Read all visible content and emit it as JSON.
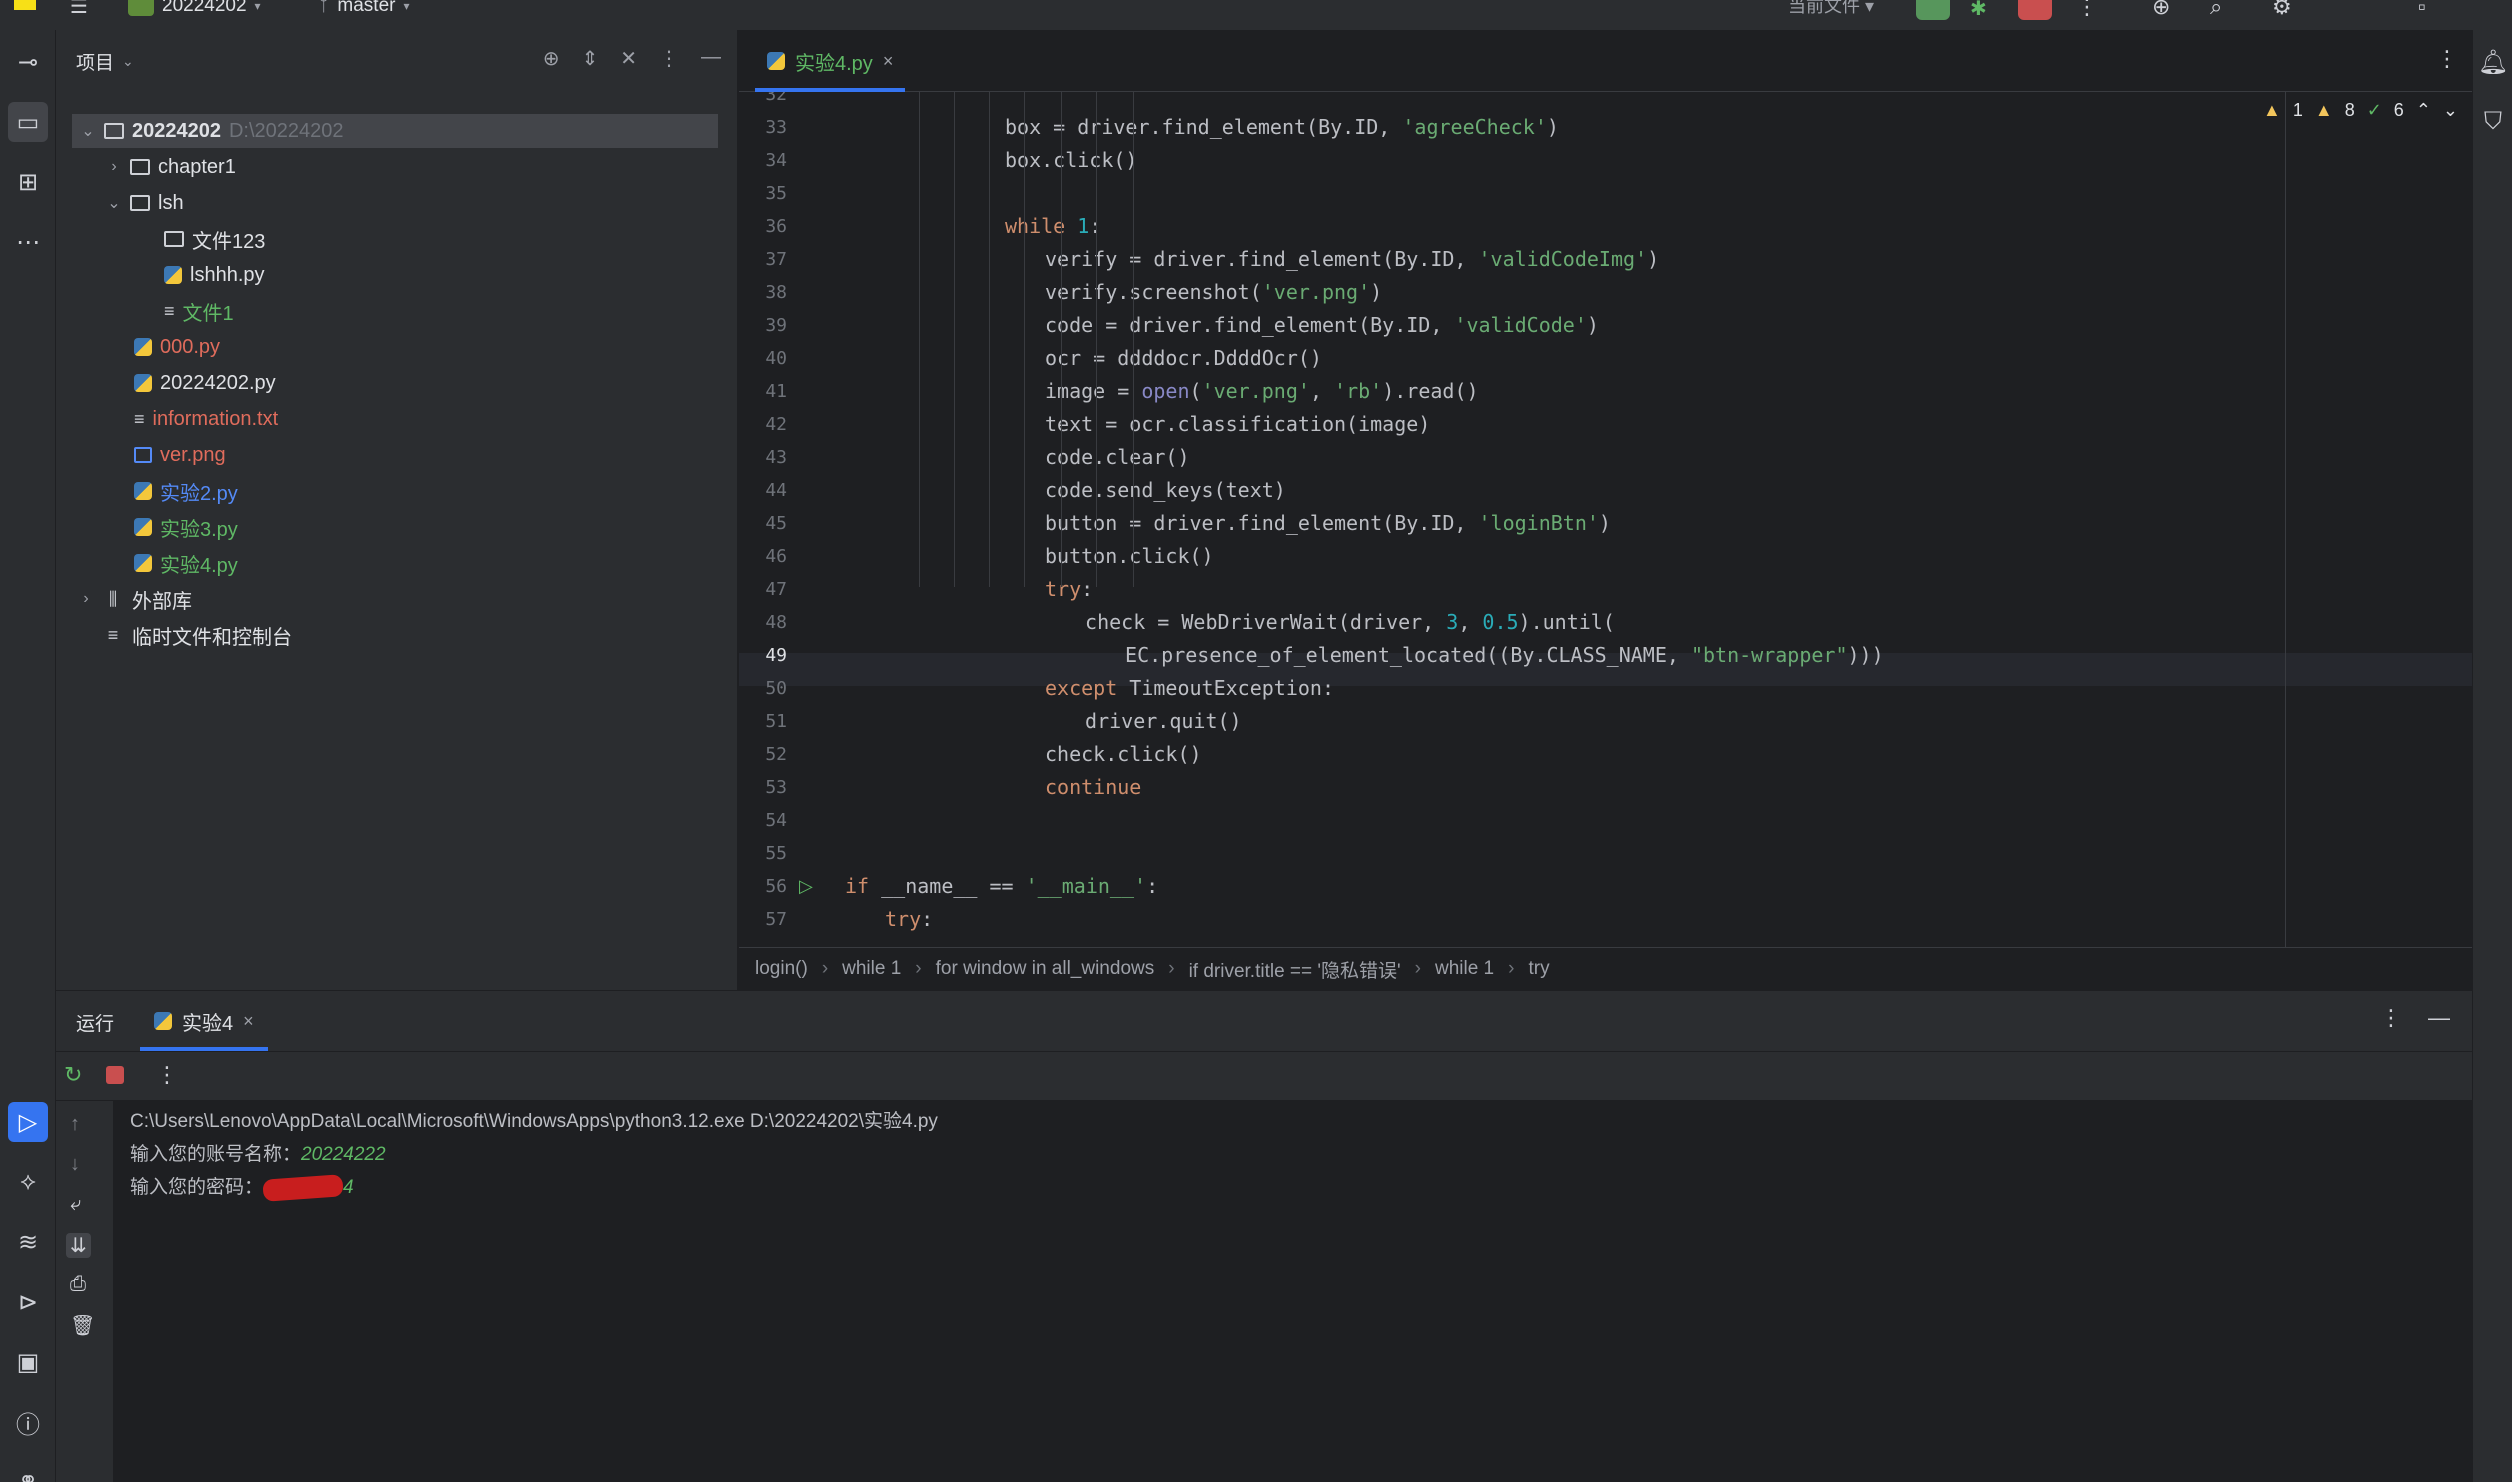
{
  "titlebar": {
    "project": "20224202",
    "branch": "master",
    "current_file": "当前文件"
  },
  "project_panel": {
    "title": "项目",
    "tree": [
      {
        "label": "20224202",
        "path": "D:\\20224202",
        "type": "folder",
        "level": 0,
        "expanded": true,
        "selected": true
      },
      {
        "label": "chapter1",
        "type": "folder",
        "level": 1,
        "expanded": false
      },
      {
        "label": "lsh",
        "type": "folder",
        "level": 1,
        "expanded": true
      },
      {
        "label": "文件123",
        "type": "folder",
        "level": 2
      },
      {
        "label": "lshhh.py",
        "type": "py",
        "level": 2
      },
      {
        "label": "文件1",
        "type": "txt",
        "level": 2
      },
      {
        "label": "000.py",
        "type": "py",
        "level": 1
      },
      {
        "label": "20224202.py",
        "type": "py",
        "level": 1
      },
      {
        "label": "information.txt",
        "type": "txt",
        "level": 1
      },
      {
        "label": "ver.png",
        "type": "img",
        "level": 1
      },
      {
        "label": "实验2.py",
        "type": "py",
        "level": 1
      },
      {
        "label": "实验3.py",
        "type": "py",
        "level": 1
      },
      {
        "label": "实验4.py",
        "type": "py",
        "level": 1
      },
      {
        "label": "外部库",
        "type": "lib",
        "level": 0
      },
      {
        "label": "临时文件和控制台",
        "type": "scratch",
        "level": 0
      }
    ]
  },
  "editor": {
    "tab": "实验4.py",
    "inspections": {
      "errors": "1",
      "warnings": "8",
      "ok": "6"
    },
    "current_line": 49,
    "lines": [
      {
        "n": "32",
        "code": ""
      },
      {
        "n": "33",
        "code": "box = driver.find_element(By.ID, 'agreeCheck')"
      },
      {
        "n": "34",
        "code": "box.click()"
      },
      {
        "n": "35",
        "code": ""
      },
      {
        "n": "36",
        "code": "while 1:"
      },
      {
        "n": "37",
        "code": "verify = driver.find_element(By.ID, 'validCodeImg')"
      },
      {
        "n": "38",
        "code": "verify.screenshot('ver.png')"
      },
      {
        "n": "39",
        "code": "code = driver.find_element(By.ID, 'validCode')"
      },
      {
        "n": "40",
        "code": "ocr = ddddocr.DdddOcr()"
      },
      {
        "n": "41",
        "code": "image = open('ver.png', 'rb').read()"
      },
      {
        "n": "42",
        "code": "text = ocr.classification(image)"
      },
      {
        "n": "43",
        "code": "code.clear()"
      },
      {
        "n": "44",
        "code": "code.send_keys(text)"
      },
      {
        "n": "45",
        "code": "button = driver.find_element(By.ID, 'loginBtn')"
      },
      {
        "n": "46",
        "code": "button.click()"
      },
      {
        "n": "47",
        "code": "try:"
      },
      {
        "n": "48",
        "code": "check = WebDriverWait(driver, 3, 0.5).until("
      },
      {
        "n": "49",
        "code": "EC.presence_of_element_located((By.CLASS_NAME, \"btn-wrapper\")))"
      },
      {
        "n": "50",
        "code": "except TimeoutException:"
      },
      {
        "n": "51",
        "code": "driver.quit()"
      },
      {
        "n": "52",
        "code": "check.click()"
      },
      {
        "n": "53",
        "code": "continue"
      },
      {
        "n": "54",
        "code": ""
      },
      {
        "n": "55",
        "code": ""
      },
      {
        "n": "56",
        "code": "if __name__ == '__main__':"
      },
      {
        "n": "57",
        "code": "try:"
      }
    ]
  },
  "breadcrumb": [
    "login()",
    "while 1",
    "for window in all_windows",
    "if driver.title == '隐私错误'",
    "while 1",
    "try"
  ],
  "run_panel": {
    "label": "运行",
    "tab": "实验4",
    "console": [
      "C:\\Users\\Lenovo\\AppData\\Local\\Microsoft\\WindowsApps\\python3.12.exe D:\\20224202\\实验4.py",
      "输入您的账号名称：",
      "输入您的密码："
    ],
    "account_input": "20224222",
    "password_input_tail": "4"
  },
  "colors": {
    "accent": "#3574f0",
    "run_green": "#57965c",
    "stop_red": "#c94f4f",
    "modified_green": "#5fb865",
    "unversioned_red": "#e06c5c",
    "added_blue": "#548af7"
  }
}
